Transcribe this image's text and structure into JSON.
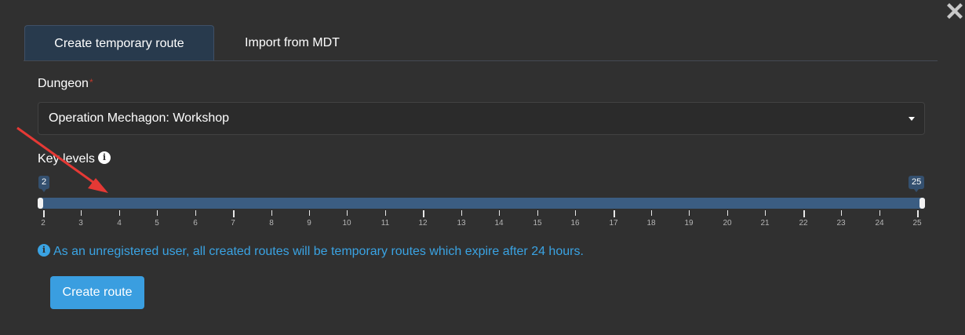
{
  "tabs": [
    {
      "label": "Create temporary route",
      "active": true
    },
    {
      "label": "Import from MDT",
      "active": false
    }
  ],
  "dungeon": {
    "label": "Dungeon",
    "required_mark": "*",
    "selected": "Operation Mechagon: Workshop"
  },
  "key_levels": {
    "label": "Key levels",
    "min": 2,
    "max": 25,
    "from": "2",
    "to": "25",
    "ticks": [
      "2",
      "3",
      "4",
      "5",
      "6",
      "7",
      "8",
      "9",
      "10",
      "11",
      "12",
      "13",
      "14",
      "15",
      "16",
      "17",
      "18",
      "19",
      "20",
      "21",
      "22",
      "23",
      "24",
      "25"
    ]
  },
  "notice": {
    "text": "As an unregistered user, all created routes will be temporary routes which expire after 24 hours."
  },
  "create_button": {
    "label": "Create route"
  },
  "colors": {
    "background": "#303030",
    "accent": "#3a9ee0",
    "slider_track": "#3b5d82",
    "annotation_arrow": "#e53935"
  }
}
